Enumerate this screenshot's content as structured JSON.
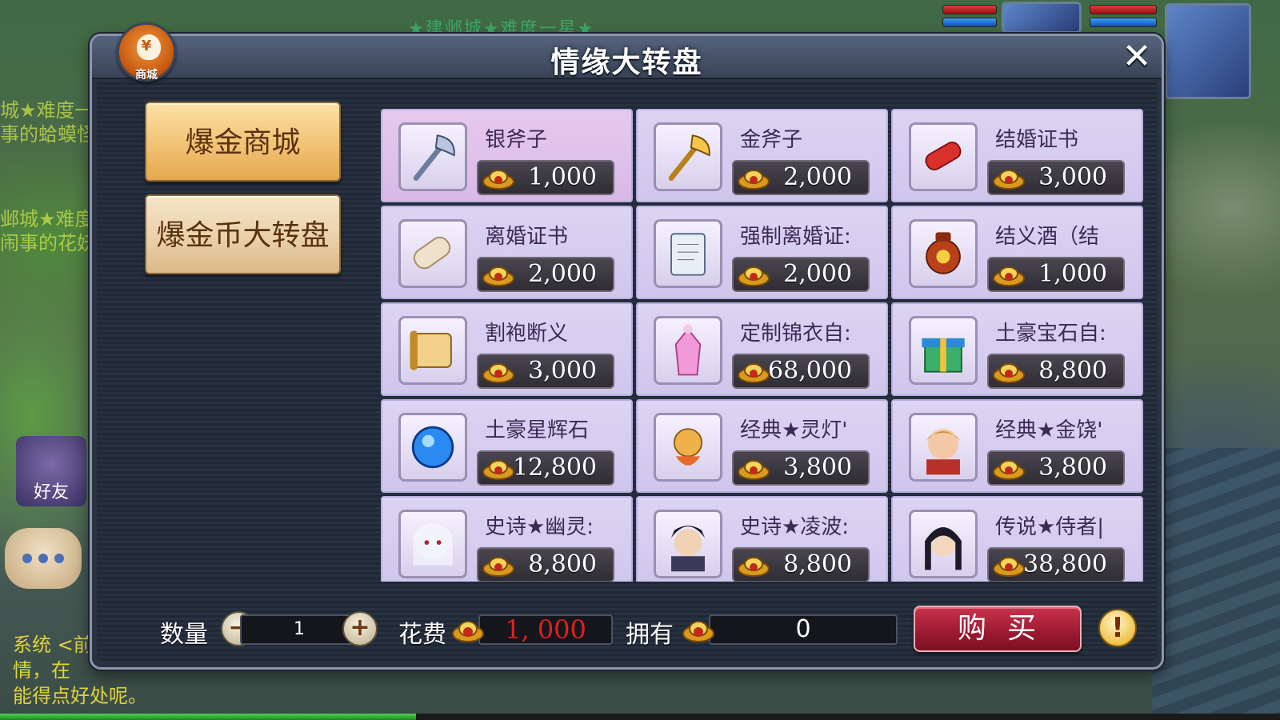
{
  "background": {
    "top_text": "★建邺城★难度一星★",
    "left_texts": [
      "城★难度一",
      "事的蛤蟆怪",
      "邺城★难度",
      "闹事的花妖"
    ],
    "friend_label": "好友",
    "chat_lines": [
      "系统 <前",
      "情，在",
      "能得点好处呢。"
    ]
  },
  "dialog": {
    "title": "情缘大转盘",
    "close_label": "✕",
    "mall_badge": {
      "icon": "money-bag-icon",
      "symbol": "¥",
      "label": "商城"
    }
  },
  "tabs": [
    {
      "label": "爆金商城",
      "state": "active"
    },
    {
      "label": "爆金币大转盘",
      "state": "inactive"
    }
  ],
  "items": [
    {
      "name": "银斧子",
      "price": "1,000",
      "icon": "silver-axe-icon"
    },
    {
      "name": "金斧子",
      "price": "2,000",
      "icon": "gold-axe-icon"
    },
    {
      "name": "结婚证书",
      "price": "3,000",
      "icon": "red-scroll-icon"
    },
    {
      "name": "离婚证书",
      "price": "2,000",
      "icon": "paper-scroll-icon"
    },
    {
      "name": "强制离婚证:",
      "price": "2,000",
      "icon": "document-icon"
    },
    {
      "name": "结义酒（结",
      "price": "1,000",
      "icon": "wine-jar-icon"
    },
    {
      "name": "割袍断义",
      "price": "3,000",
      "icon": "yellow-scroll-icon"
    },
    {
      "name": "定制锦衣自:",
      "price": "68,000",
      "icon": "pink-robe-icon"
    },
    {
      "name": "土豪宝石自:",
      "price": "8,800",
      "icon": "gift-box-icon"
    },
    {
      "name": "土豪星辉石",
      "price": "12,800",
      "icon": "blue-gem-icon"
    },
    {
      "name": "经典★灵灯'",
      "price": "3,800",
      "icon": "lantern-spirit-icon"
    },
    {
      "name": "经典★金饶'",
      "price": "3,800",
      "icon": "hero-portrait-icon"
    },
    {
      "name": "史诗★幽灵:",
      "price": "8,800",
      "icon": "ghost-portrait-icon"
    },
    {
      "name": "史诗★凌波:",
      "price": "8,800",
      "icon": "warrior-portrait-icon"
    },
    {
      "name": "传说★侍者|",
      "price": "38,800",
      "icon": "attendant-portrait-icon"
    }
  ],
  "bottom": {
    "quantity_label": "数量",
    "quantity": "1",
    "minus": "−",
    "plus": "+",
    "cost_label": "花费",
    "cost": "1, 000",
    "own_label": "拥有",
    "own": "0",
    "buy_label": "购买",
    "info": "!"
  },
  "colors": {
    "card_bg": "#dcd4f2",
    "tab_active": "#f2c275",
    "buy_button": "#9a1a30",
    "cost_text": "#e02020"
  }
}
